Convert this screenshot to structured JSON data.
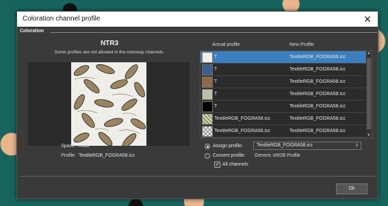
{
  "window": {
    "title": "Coloration channel profile",
    "close_glyph": "✕"
  },
  "section": {
    "header": "Coloration"
  },
  "left": {
    "profile_name": "NTR3",
    "note": "Some profiles are not allowed in the colorway channels.",
    "space_label": "Space:",
    "space_value": "RGB",
    "profile_label": "Profile:",
    "profile_value": "TextileRGB_FOGRA58.icc"
  },
  "table": {
    "columns": {
      "actual": "Actual profile",
      "new": "New Profile"
    },
    "rows": [
      {
        "swatch_color": "#f0efe8",
        "actual": "T",
        "new": "TextileRGB_FOGRA58.icc",
        "selected": true
      },
      {
        "swatch_color": "#3b5e93",
        "actual": "T",
        "new": "TextileRGB_FOGRA58.icc",
        "selected": false
      },
      {
        "swatch_color": "#93674a",
        "actual": "T",
        "new": "TextileRGB_FOGRA58.icc",
        "selected": false
      },
      {
        "swatch_color": "#b7c2a6",
        "actual": "T",
        "new": "TextileRGB_FOGRA58.icc",
        "selected": false
      },
      {
        "swatch_color": "#050505",
        "actual": "T",
        "new": "TextileRGB_FOGRA58.icc",
        "selected": false
      },
      {
        "swatch_color": "#d8d8b8",
        "actual": "TextileRGB_FOGRA58.icc",
        "new": "TextileRGB_FOGRA58.icc",
        "selected": false
      },
      {
        "swatch_color": "#e8e8e8",
        "actual": "TextileRGB_FOGRA58.icc",
        "new": "TextileRGB_FOGRA58.icc",
        "selected": false
      }
    ]
  },
  "options": {
    "assign_label": "Assign profile:",
    "assign_value": "TextileRGB_FOGRA58.icc",
    "convert_label": "Convert profile:",
    "convert_value": "Generic sRGB Profile",
    "all_channels_label": "All channels",
    "all_channels_checked": "✓"
  },
  "footer": {
    "ok_label": "Ok"
  }
}
